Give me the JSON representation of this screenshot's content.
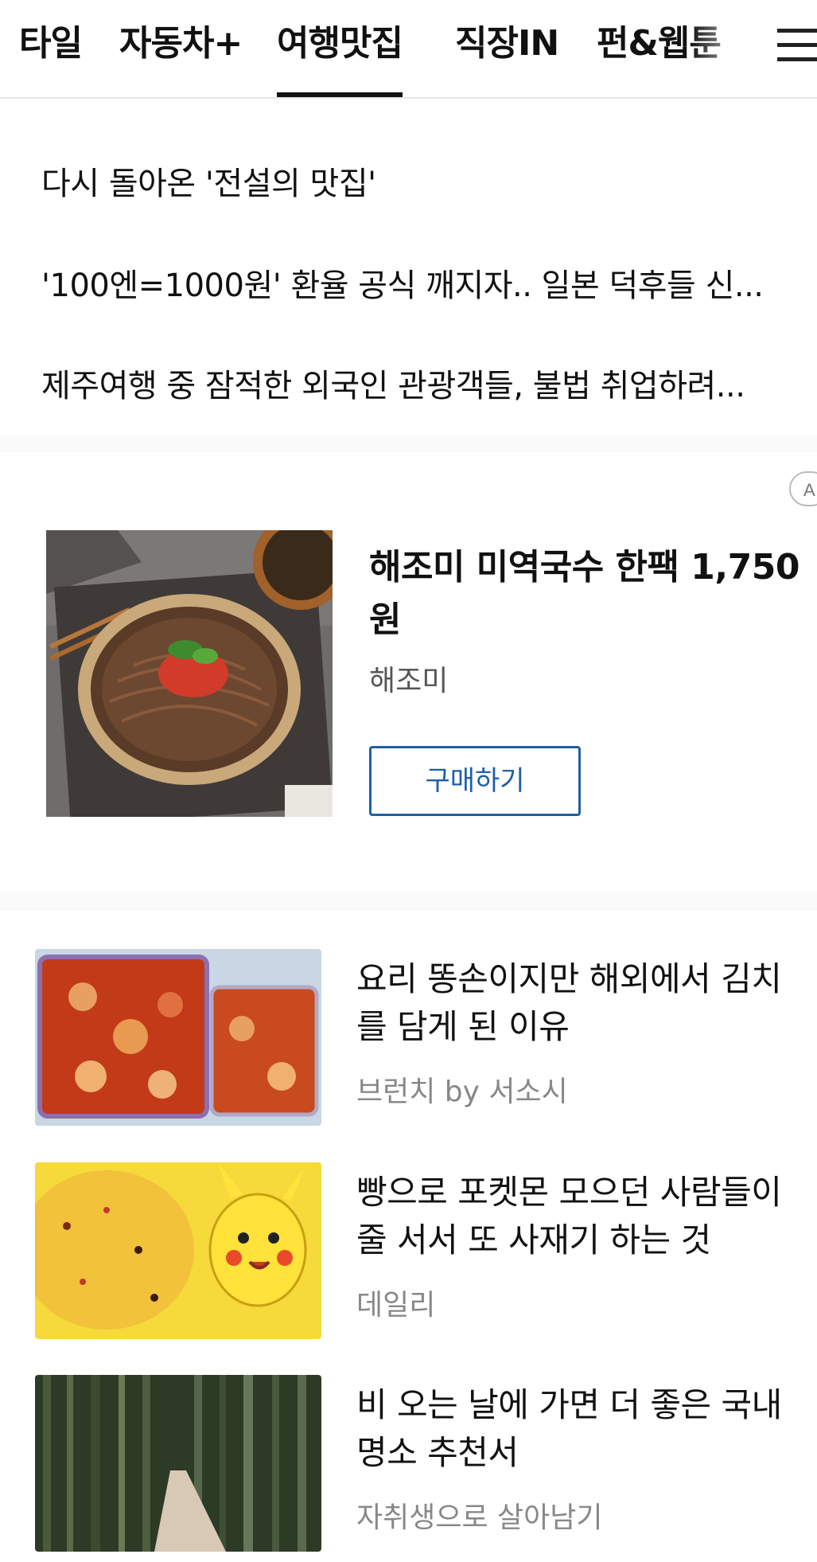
{
  "tabs": [
    {
      "label": "타일",
      "active": false
    },
    {
      "label": "자동차+",
      "active": false
    },
    {
      "label": "여행맛집",
      "active": true
    },
    {
      "label": "직장IN",
      "active": false
    },
    {
      "label": "펀&웹툰",
      "active": false
    }
  ],
  "menu_icon": "hamburger-menu-icon",
  "headlines": [
    "다시 돌아온 '전설의 맛집'",
    "'100엔=1000원' 환율 공식 깨지자.. 일본 덕후들 신...",
    "제주여행 중 잠적한 외국인 관광객들, 불법 취업하려..."
  ],
  "ad": {
    "badge": "A",
    "title": "해조미 미역국수 한팩 1,750원",
    "brand": "해조미",
    "button_label": "구매하기",
    "button_color": "#1f5fa8"
  },
  "articles": [
    {
      "title": "요리 똥손이지만 해외에서 김치를 담게 된 이유",
      "source": "브런치 by 서소시"
    },
    {
      "title": "빵으로 포켓몬 모으던 사람들이 줄 서서 또 사재기 하는 것",
      "source": "데일리"
    },
    {
      "title": "비 오는 날에 가면 더 좋은 국내 명소 추천서",
      "source": "자취생으로 살아남기"
    }
  ]
}
